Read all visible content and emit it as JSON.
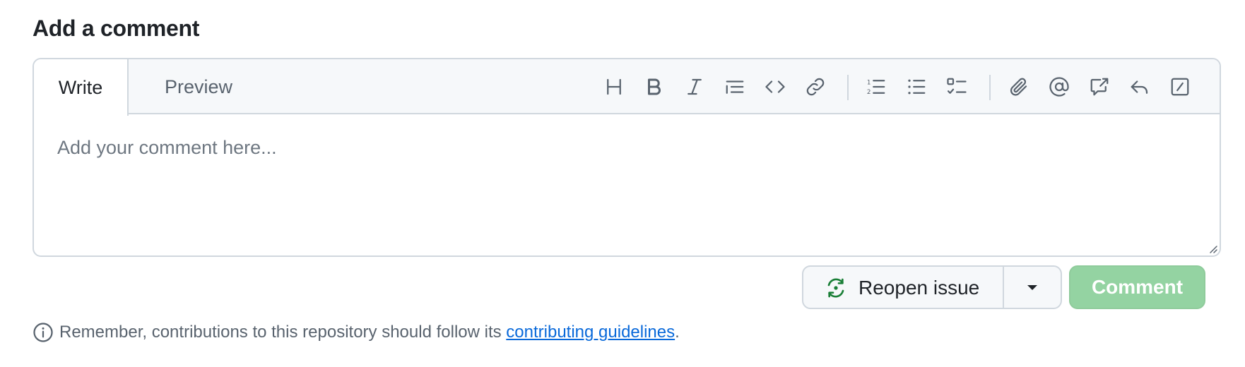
{
  "heading": "Add a comment",
  "tabs": {
    "write": "Write",
    "preview": "Preview",
    "active": "Write"
  },
  "toolbar": {
    "items": [
      {
        "name": "heading-icon",
        "label": "Heading"
      },
      {
        "name": "bold-icon",
        "label": "Bold"
      },
      {
        "name": "italic-icon",
        "label": "Italic"
      },
      {
        "name": "quote-icon",
        "label": "Quote"
      },
      {
        "name": "code-icon",
        "label": "Code"
      },
      {
        "name": "link-icon",
        "label": "Link"
      },
      {
        "name": "numbered-list-icon",
        "label": "Numbered list"
      },
      {
        "name": "unordered-list-icon",
        "label": "Unordered list"
      },
      {
        "name": "task-list-icon",
        "label": "Task list"
      },
      {
        "name": "attach-icon",
        "label": "Attach files"
      },
      {
        "name": "mention-icon",
        "label": "Mention"
      },
      {
        "name": "reference-icon",
        "label": "Reference"
      },
      {
        "name": "reply-icon",
        "label": "Saved replies"
      },
      {
        "name": "slash-commands-icon",
        "label": "Slash commands"
      }
    ]
  },
  "editor": {
    "value": "",
    "placeholder": "Add your comment here..."
  },
  "actions": {
    "reopen_label": "Reopen issue",
    "comment_label": "Comment"
  },
  "footnote": {
    "prefix": "Remember, contributions to this repository should follow its ",
    "link": "contributing guidelines",
    "suffix": "."
  },
  "colors": {
    "accent_link": "#0969da",
    "comment_button_disabled": "#94d3a2",
    "reopen_icon": "#1a7f37"
  }
}
